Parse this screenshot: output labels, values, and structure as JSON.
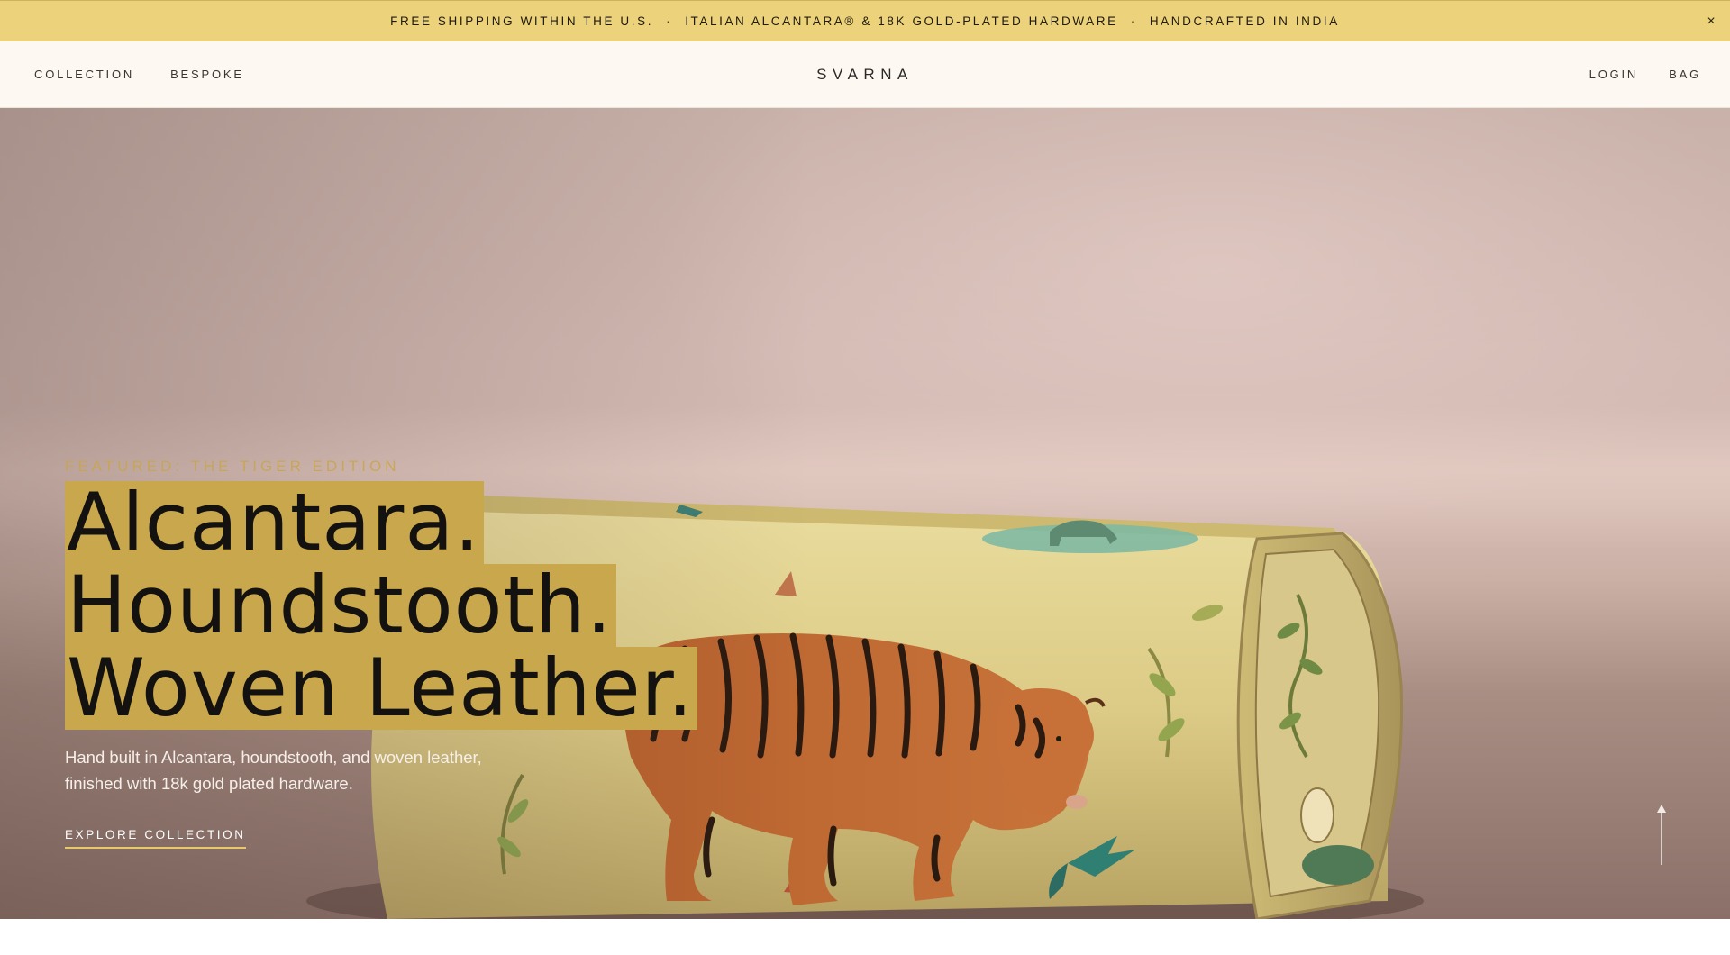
{
  "announcement": {
    "items": [
      "FREE SHIPPING WITHIN THE U.S.",
      "ITALIAN ALCANTARA® & 18K GOLD-PLATED HARDWARE",
      "HANDCRAFTED IN INDIA"
    ],
    "separator": "·",
    "close_glyph": "×"
  },
  "header": {
    "nav_left": [
      "COLLECTION",
      "BESPOKE"
    ],
    "logo": "SVARNA",
    "nav_right": [
      "LOGIN",
      "BAG"
    ]
  },
  "hero": {
    "eyebrow": "FEATURED: THE TIGER EDITION",
    "headline": [
      "Alcantara.",
      "Houndstooth.",
      "Woven Leather."
    ],
    "subcopy": "Hand built in Alcantara, houndstooth, and woven leather, finished with 18k gold plated hardware.",
    "cta": "EXPLORE COLLECTION",
    "scroll_icon": "arrow-up-icon"
  },
  "colors": {
    "announcement_bg": "#ecd27a",
    "header_bg": "#fdf9f2",
    "highlight_gold": "#c9a84d",
    "cta_underline": "#e7c86b"
  }
}
